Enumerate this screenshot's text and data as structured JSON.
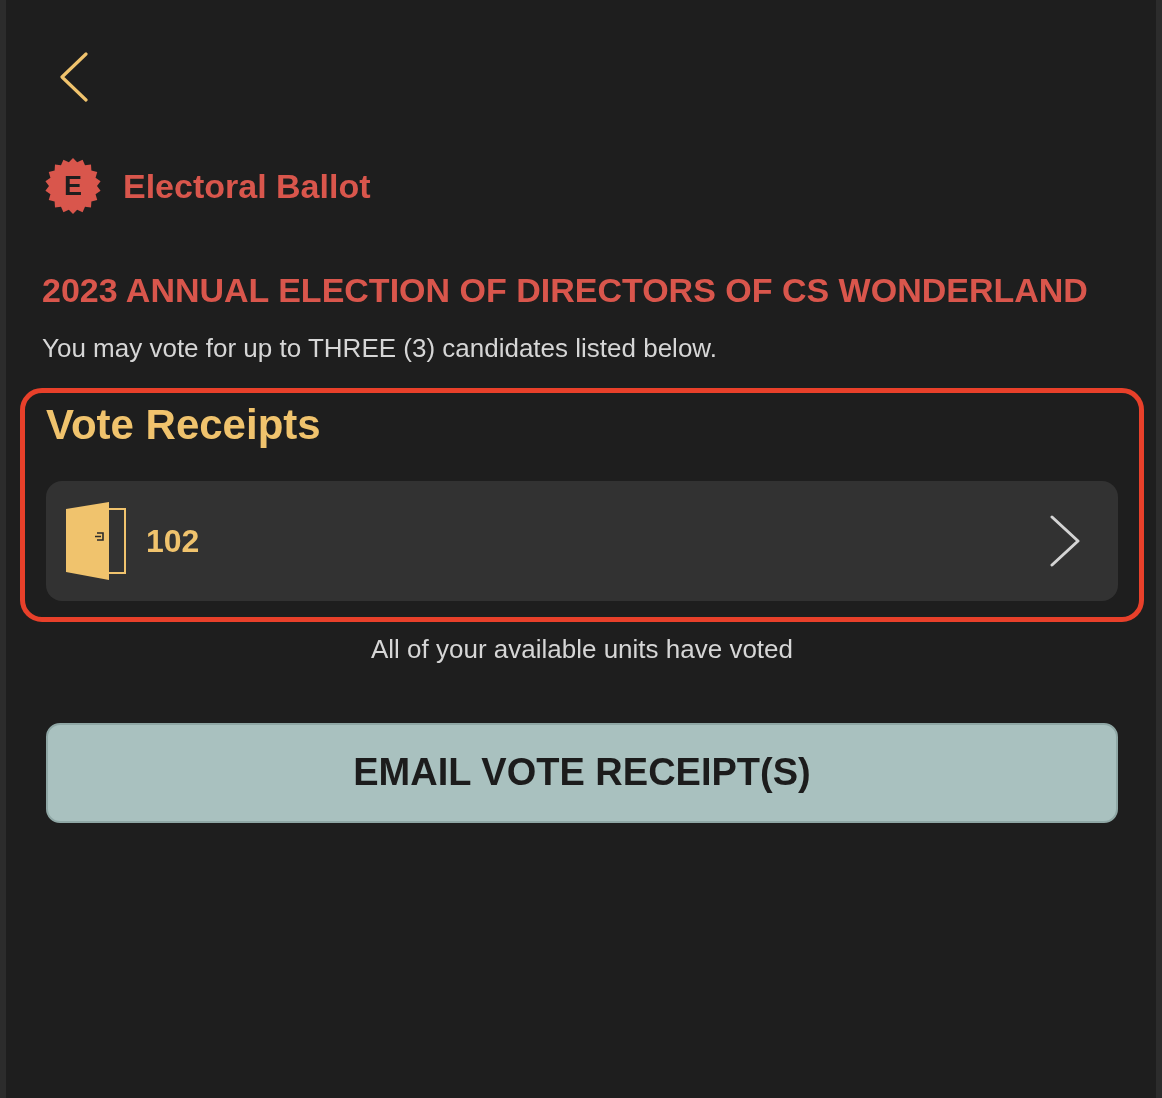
{
  "app": {
    "logo_letter": "E",
    "title": "Electoral Ballot"
  },
  "election": {
    "title": "2023 ANNUAL ELECTION OF DIRECTORS OF CS WONDERLAND",
    "instructions": "You may vote for up to THREE (3) candidates listed below."
  },
  "receipts": {
    "heading": "Vote Receipts",
    "highlighted": true,
    "items": [
      {
        "unit": "102"
      }
    ]
  },
  "status_message": "All of your available units have voted",
  "email_button": {
    "label": "EMAIL VOTE RECEIPT(S)"
  }
}
